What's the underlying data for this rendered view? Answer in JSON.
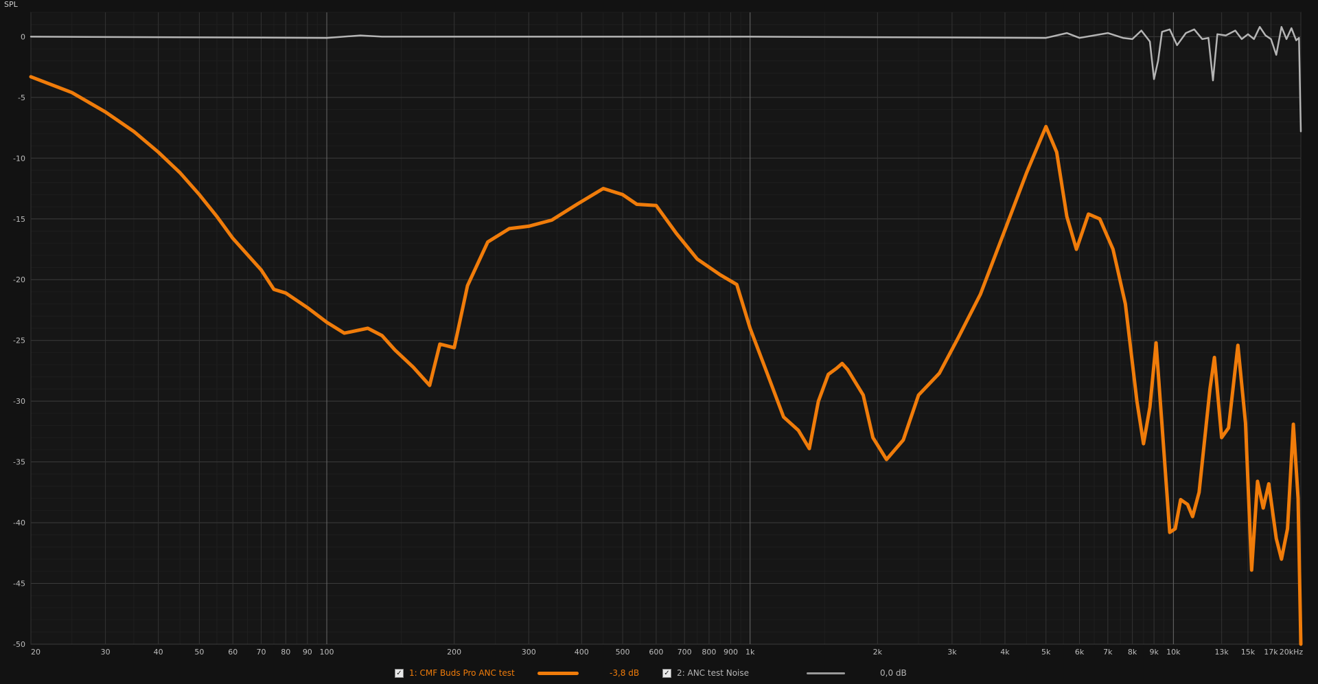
{
  "chart_data": {
    "type": "line",
    "ylabel": "SPL",
    "x_scale": "log",
    "xlim": [
      20,
      20000
    ],
    "ylim": [
      -50,
      2
    ],
    "y_ticks": [
      0,
      -5,
      -10,
      -15,
      -20,
      -25,
      -30,
      -35,
      -40,
      -45,
      -50
    ],
    "x_ticks": [
      {
        "v": 20,
        "l": "20"
      },
      {
        "v": 30,
        "l": "30"
      },
      {
        "v": 40,
        "l": "40"
      },
      {
        "v": 50,
        "l": "50"
      },
      {
        "v": 60,
        "l": "60"
      },
      {
        "v": 70,
        "l": "70"
      },
      {
        "v": 80,
        "l": "80"
      },
      {
        "v": 90,
        "l": "90"
      },
      {
        "v": 100,
        "l": "100"
      },
      {
        "v": 200,
        "l": "200"
      },
      {
        "v": 300,
        "l": "300"
      },
      {
        "v": 400,
        "l": "400"
      },
      {
        "v": 500,
        "l": "500"
      },
      {
        "v": 600,
        "l": "600"
      },
      {
        "v": 700,
        "l": "700"
      },
      {
        "v": 800,
        "l": "800"
      },
      {
        "v": 900,
        "l": "900"
      },
      {
        "v": 1000,
        "l": "1k"
      },
      {
        "v": 2000,
        "l": "2k"
      },
      {
        "v": 3000,
        "l": "3k"
      },
      {
        "v": 4000,
        "l": "4k"
      },
      {
        "v": 5000,
        "l": "5k"
      },
      {
        "v": 6000,
        "l": "6k"
      },
      {
        "v": 7000,
        "l": "7k"
      },
      {
        "v": 8000,
        "l": "8k"
      },
      {
        "v": 9000,
        "l": "9k"
      },
      {
        "v": 10000,
        "l": "10k"
      },
      {
        "v": 13000,
        "l": "13k"
      },
      {
        "v": 15000,
        "l": "15k"
      },
      {
        "v": 17000,
        "l": "17k"
      },
      {
        "v": 20000,
        "l": "20kHz"
      }
    ],
    "grid": true,
    "series": [
      {
        "name": "1: CMF Buds Pro ANC test",
        "color": "#f07c0a",
        "legend_value": "-3,8 dB",
        "points": [
          [
            20,
            -3.3
          ],
          [
            25,
            -4.6
          ],
          [
            30,
            -6.2
          ],
          [
            35,
            -7.8
          ],
          [
            40,
            -9.5
          ],
          [
            45,
            -11.2
          ],
          [
            50,
            -13
          ],
          [
            55,
            -14.8
          ],
          [
            60,
            -16.6
          ],
          [
            70,
            -19.2
          ],
          [
            75,
            -20.8
          ],
          [
            80,
            -21.1
          ],
          [
            90,
            -22.3
          ],
          [
            100,
            -23.5
          ],
          [
            110,
            -24.4
          ],
          [
            125,
            -24
          ],
          [
            135,
            -24.6
          ],
          [
            145,
            -25.8
          ],
          [
            160,
            -27.2
          ],
          [
            175,
            -28.7
          ],
          [
            185,
            -25.3
          ],
          [
            200,
            -25.6
          ],
          [
            215,
            -20.5
          ],
          [
            240,
            -16.9
          ],
          [
            270,
            -15.8
          ],
          [
            300,
            -15.6
          ],
          [
            340,
            -15.1
          ],
          [
            390,
            -13.8
          ],
          [
            450,
            -12.5
          ],
          [
            500,
            -13
          ],
          [
            540,
            -13.8
          ],
          [
            600,
            -13.9
          ],
          [
            670,
            -16.2
          ],
          [
            750,
            -18.3
          ],
          [
            850,
            -19.6
          ],
          [
            930,
            -20.4
          ],
          [
            1000,
            -24
          ],
          [
            1100,
            -27.8
          ],
          [
            1200,
            -31.3
          ],
          [
            1300,
            -32.4
          ],
          [
            1380,
            -33.9
          ],
          [
            1450,
            -30
          ],
          [
            1530,
            -27.8
          ],
          [
            1600,
            -27.3
          ],
          [
            1650,
            -26.9
          ],
          [
            1700,
            -27.4
          ],
          [
            1850,
            -29.5
          ],
          [
            1950,
            -33
          ],
          [
            2100,
            -34.8
          ],
          [
            2300,
            -33.2
          ],
          [
            2500,
            -29.5
          ],
          [
            2800,
            -27.7
          ],
          [
            3100,
            -24.8
          ],
          [
            3500,
            -21.2
          ],
          [
            4000,
            -15.9
          ],
          [
            4500,
            -11.2
          ],
          [
            5000,
            -7.4
          ],
          [
            5300,
            -9.5
          ],
          [
            5600,
            -14.8
          ],
          [
            5900,
            -17.5
          ],
          [
            6300,
            -14.6
          ],
          [
            6700,
            -15
          ],
          [
            7200,
            -17.5
          ],
          [
            7700,
            -22
          ],
          [
            8200,
            -30
          ],
          [
            8500,
            -33.5
          ],
          [
            8800,
            -30.5
          ],
          [
            9100,
            -25.2
          ],
          [
            9400,
            -32
          ],
          [
            9800,
            -40.8
          ],
          [
            10100,
            -40.5
          ],
          [
            10400,
            -38.1
          ],
          [
            10800,
            -38.5
          ],
          [
            11100,
            -39.5
          ],
          [
            11500,
            -37.5
          ],
          [
            12200,
            -29
          ],
          [
            12500,
            -26.4
          ],
          [
            13000,
            -33
          ],
          [
            13500,
            -32.2
          ],
          [
            14200,
            -25.4
          ],
          [
            14800,
            -31.8
          ],
          [
            15300,
            -43.9
          ],
          [
            15800,
            -36.6
          ],
          [
            16300,
            -38.8
          ],
          [
            16800,
            -36.8
          ],
          [
            17500,
            -41.3
          ],
          [
            18000,
            -43
          ],
          [
            18600,
            -40.5
          ],
          [
            19200,
            -31.9
          ],
          [
            19700,
            -38
          ],
          [
            20000,
            -50
          ]
        ]
      },
      {
        "name": "2: ANC test Noise",
        "color": "#b5b5b5",
        "legend_value": "0,0 dB",
        "points": [
          [
            20,
            0
          ],
          [
            100,
            -0.1
          ],
          [
            120,
            0.1
          ],
          [
            135,
            0
          ],
          [
            1000,
            0
          ],
          [
            5000,
            -0.1
          ],
          [
            5600,
            0.3
          ],
          [
            6000,
            -0.1
          ],
          [
            7000,
            0.3
          ],
          [
            7600,
            -0.1
          ],
          [
            8000,
            -0.2
          ],
          [
            8400,
            0.5
          ],
          [
            8800,
            -0.4
          ],
          [
            9000,
            -3.5
          ],
          [
            9200,
            -2
          ],
          [
            9400,
            0.4
          ],
          [
            9800,
            0.6
          ],
          [
            10200,
            -0.7
          ],
          [
            10700,
            0.3
          ],
          [
            11200,
            0.6
          ],
          [
            11700,
            -0.2
          ],
          [
            12100,
            -0.1
          ],
          [
            12400,
            -3.6
          ],
          [
            12700,
            0.2
          ],
          [
            13300,
            0.1
          ],
          [
            14000,
            0.5
          ],
          [
            14500,
            -0.2
          ],
          [
            15000,
            0.2
          ],
          [
            15500,
            -0.2
          ],
          [
            16000,
            0.8
          ],
          [
            16500,
            0.1
          ],
          [
            17000,
            -0.2
          ],
          [
            17500,
            -1.5
          ],
          [
            18000,
            0.8
          ],
          [
            18500,
            -0.2
          ],
          [
            19000,
            0.7
          ],
          [
            19500,
            -0.3
          ],
          [
            19800,
            -0.1
          ],
          [
            20000,
            -7.8
          ]
        ]
      }
    ]
  },
  "legend": [
    {
      "label": "1: CMF Buds Pro ANC test",
      "value": "-3,8 dB",
      "checked": true
    },
    {
      "label": "2: ANC test Noise",
      "value": "0,0 dB",
      "checked": true
    }
  ]
}
